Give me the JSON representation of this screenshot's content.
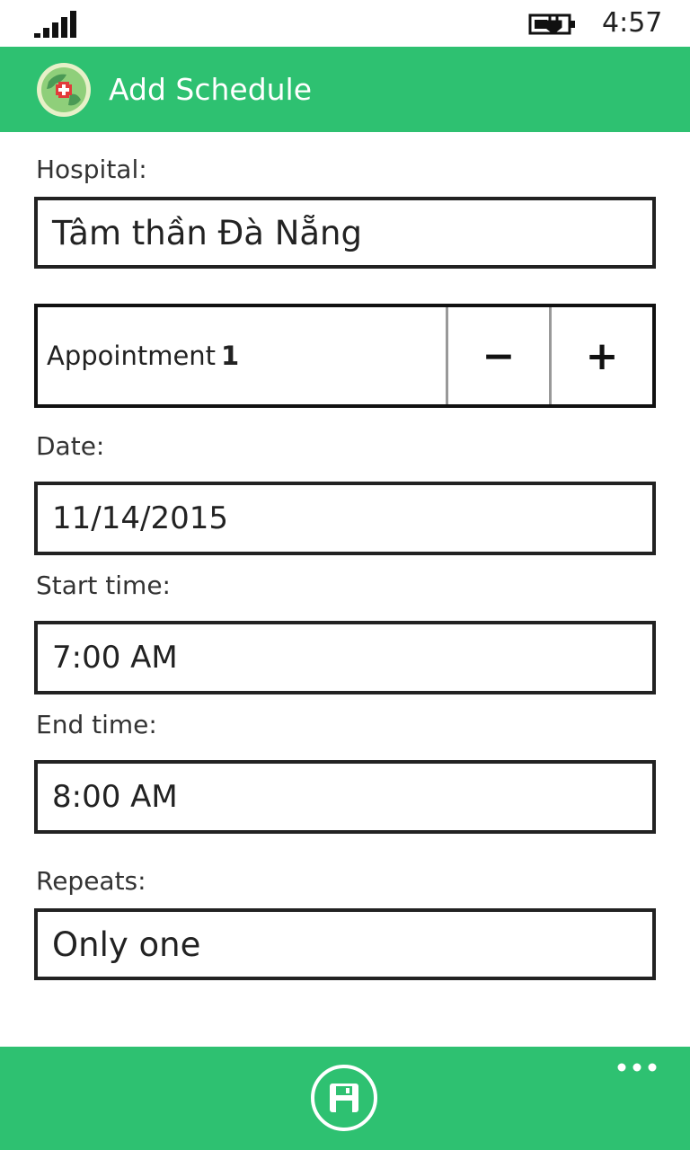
{
  "status_bar": {
    "time": "4:57",
    "signal_icon": "signal-strength-icon",
    "battery_icon": "battery-charging-icon"
  },
  "header": {
    "title": "Add Schedule",
    "logo_icon": "hospital-globe-logo",
    "color": "#2ec171"
  },
  "form": {
    "hospital_label": "Hospital:",
    "hospital_value": "Tâm thần Đà Nẵng",
    "appointment_label": "Appointment",
    "appointment_count": "1",
    "decrement_label": "−",
    "increment_label": "+",
    "date_label": "Date:",
    "date_value": "11/14/2015",
    "start_label": "Start time:",
    "start_value": "7:00 AM",
    "end_label": "End time:",
    "end_value": "8:00 AM",
    "repeats_label": "Repeats:",
    "repeats_value": "Only one"
  },
  "app_bar": {
    "save_icon": "save-icon",
    "more_icon": "more-options-icon",
    "color": "#2ec171"
  }
}
